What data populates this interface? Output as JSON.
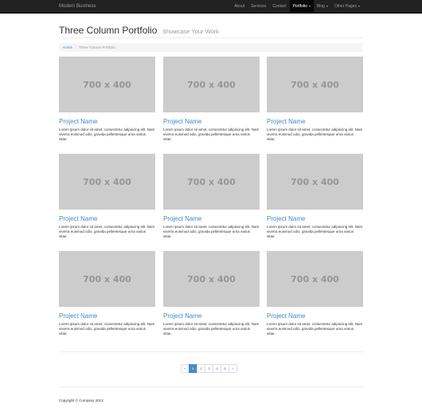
{
  "navbar": {
    "brand": "Modern Business",
    "items": [
      {
        "label": "About",
        "dropdown": false,
        "active": false
      },
      {
        "label": "Services",
        "dropdown": false,
        "active": false
      },
      {
        "label": "Contact",
        "dropdown": false,
        "active": false
      },
      {
        "label": "Portfolio",
        "dropdown": true,
        "active": true
      },
      {
        "label": "Blog",
        "dropdown": true,
        "active": false
      },
      {
        "label": "Other Pages",
        "dropdown": true,
        "active": false
      }
    ]
  },
  "header": {
    "title": "Three Column Portfolio",
    "subtitle": "Showcase Your Work"
  },
  "breadcrumb": {
    "home": "Home",
    "separator": "/",
    "current": "Three Column Portfolio"
  },
  "projects": [
    {
      "image_label": "700 x 400",
      "title": "Project Name",
      "text": "Lorem ipsum dolor sit amet, consectetur adipiscing elit. Nam viverra euismod odio, gravida pellentesque urna varius vitae."
    },
    {
      "image_label": "700 x 400",
      "title": "Project Name",
      "text": "Lorem ipsum dolor sit amet, consectetur adipiscing elit. Nam viverra euismod odio, gravida pellentesque urna varius vitae."
    },
    {
      "image_label": "700 x 400",
      "title": "Project Name",
      "text": "Lorem ipsum dolor sit amet, consectetur adipiscing elit. Nam viverra euismod odio, gravida pellentesque urna varius vitae."
    },
    {
      "image_label": "700 x 400",
      "title": "Project Name",
      "text": "Lorem ipsum dolor sit amet, consectetur adipiscing elit. Nam viverra euismod odio, gravida pellentesque urna varius vitae."
    },
    {
      "image_label": "700 x 400",
      "title": "Project Name",
      "text": "Lorem ipsum dolor sit amet, consectetur adipiscing elit. Nam viverra euismod odio, gravida pellentesque urna varius vitae."
    },
    {
      "image_label": "700 x 400",
      "title": "Project Name",
      "text": "Lorem ipsum dolor sit amet, consectetur adipiscing elit. Nam viverra euismod odio, gravida pellentesque urna varius vitae."
    },
    {
      "image_label": "700 x 400",
      "title": "Project Name",
      "text": "Lorem ipsum dolor sit amet, consectetur adipiscing elit. Nam viverra euismod odio, gravida pellentesque urna varius vitae."
    },
    {
      "image_label": "700 x 400",
      "title": "Project Name",
      "text": "Lorem ipsum dolor sit amet, consectetur adipiscing elit. Nam viverra euismod odio, gravida pellentesque urna varius vitae."
    },
    {
      "image_label": "700 x 400",
      "title": "Project Name",
      "text": "Lorem ipsum dolor sit amet, consectetur adipiscing elit. Nam viverra euismod odio, gravida pellentesque urna varius vitae."
    }
  ],
  "pagination": {
    "prev": "«",
    "pages": [
      "1",
      "2",
      "3",
      "4",
      "5"
    ],
    "active_page": "1",
    "next": "»"
  },
  "footer": {
    "copyright": "Copyright © Company 2013"
  },
  "colors": {
    "navbar_bg": "#222222",
    "link": "#428bca",
    "placeholder_bg": "#cccccc",
    "placeholder_text": "#969696"
  }
}
